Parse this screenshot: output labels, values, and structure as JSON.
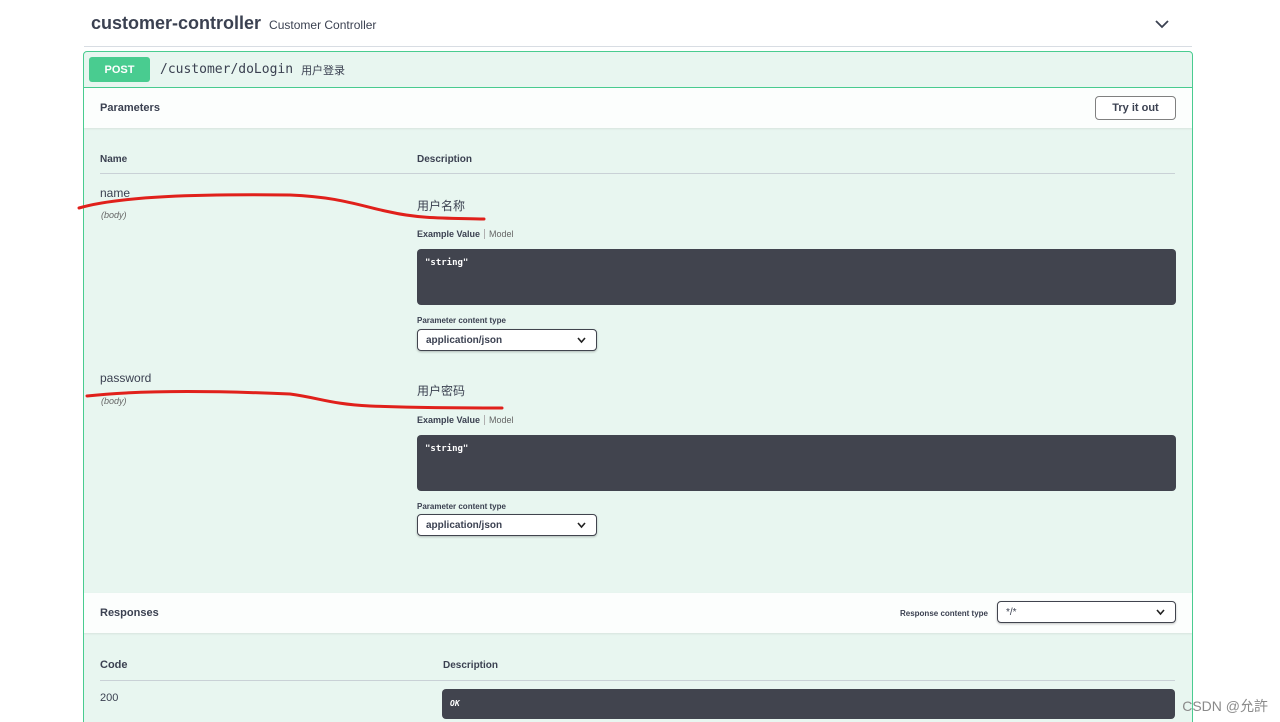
{
  "tag": {
    "name": "customer-controller",
    "description": "Customer Controller"
  },
  "operation": {
    "method": "POST",
    "path": "/customer/doLogin",
    "summary": "用户登录"
  },
  "parameters": {
    "title": "Parameters",
    "try_label": "Try it out",
    "col_name": "Name",
    "col_description": "Description",
    "items": [
      {
        "name": "name",
        "in": "(body)",
        "description": "用户名称",
        "tab_example": "Example Value",
        "tab_model": "Model",
        "example": "\"string\"",
        "content_type_label": "Parameter content type",
        "content_type": "application/json"
      },
      {
        "name": "password",
        "in": "(body)",
        "description": "用户密码",
        "tab_example": "Example Value",
        "tab_model": "Model",
        "example": "\"string\"",
        "content_type_label": "Parameter content type",
        "content_type": "application/json"
      }
    ]
  },
  "responses": {
    "title": "Responses",
    "content_type_label": "Response content type",
    "content_type": "*/*",
    "col_code": "Code",
    "col_description": "Description",
    "items": [
      {
        "code": "200",
        "description": "OK"
      }
    ]
  },
  "watermark": "CSDN @允許",
  "colors": {
    "post": "#49cc90",
    "post_bg": "#e8f6f0",
    "code_bg": "#41444e",
    "annotation": "#e0201b"
  }
}
